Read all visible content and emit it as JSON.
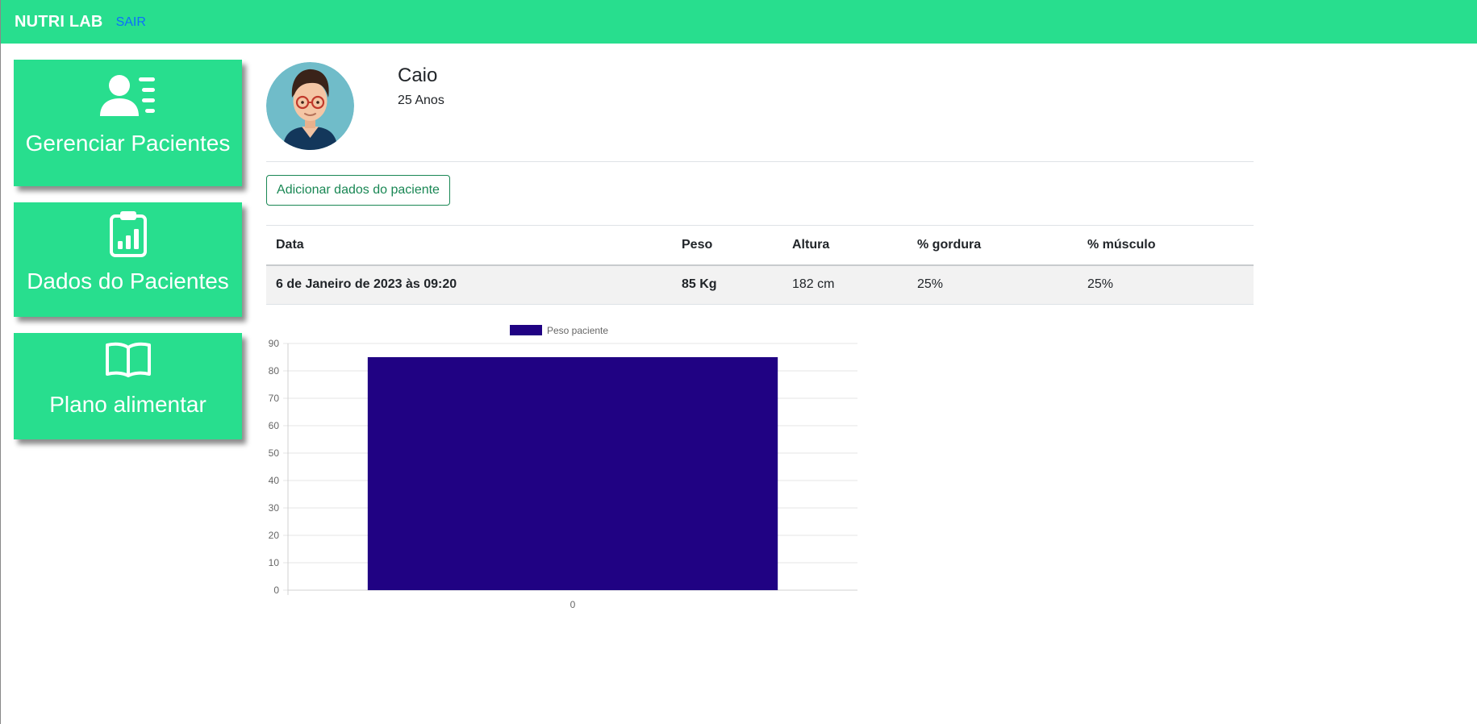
{
  "app": {
    "brand": "NUTRI LAB",
    "logout_label": "SAIR",
    "accent_color": "#28de8e",
    "link_color": "#0d6efd"
  },
  "sidebar": {
    "items": [
      {
        "label": "Gerenciar Pacientes",
        "icon": "patients-list-icon"
      },
      {
        "label": "Dados do Pacientes",
        "icon": "clipboard-chart-icon"
      },
      {
        "label": "Plano alimentar",
        "icon": "open-book-icon"
      }
    ]
  },
  "patient": {
    "name": "Caio",
    "age": "25 Anos",
    "avatar": "avatar-man-glasses"
  },
  "actions": {
    "add_data_label": "Adicionar dados do paciente",
    "add_data_color": "#198754"
  },
  "table": {
    "headers": [
      "Data",
      "Peso",
      "Altura",
      "% gordura",
      "% músculo"
    ],
    "rows": [
      [
        "6 de Janeiro de 2023 às 09:20",
        "85 Kg",
        "182 cm",
        "25%",
        "25%"
      ]
    ]
  },
  "chart_data": {
    "type": "bar",
    "categories": [
      "0"
    ],
    "series": [
      {
        "name": "Peso paciente",
        "values": [
          85
        ],
        "color": "#200283"
      }
    ],
    "ylim": [
      0,
      90
    ],
    "yticks": [
      0,
      10,
      20,
      30,
      40,
      50,
      60,
      70,
      80,
      90
    ],
    "grid": true,
    "legend": "top"
  }
}
